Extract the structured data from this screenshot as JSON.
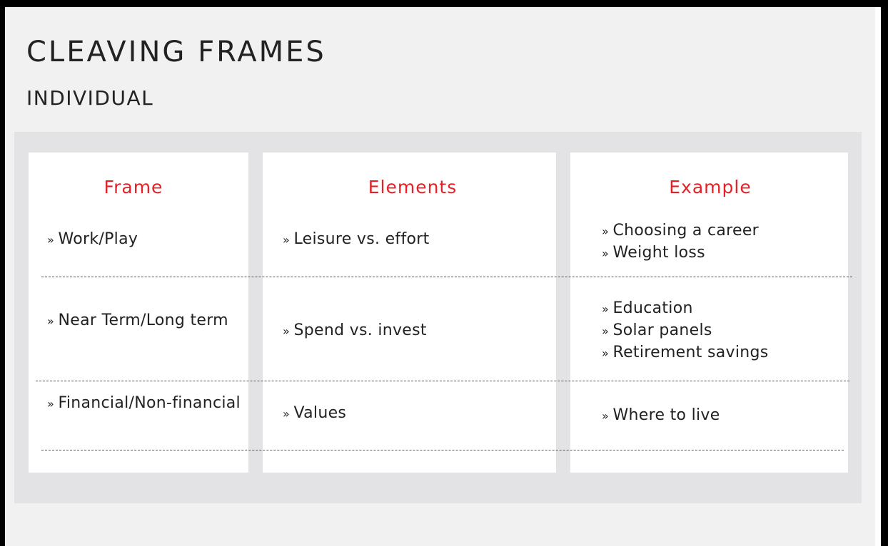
{
  "title": "CLEAVING FRAMES",
  "subtitle": "INDIVIDUAL",
  "headers": {
    "frame": "Frame",
    "elements": "Elements",
    "example": "Example"
  },
  "rows": [
    {
      "frame": "Work/Play",
      "elements": "Leisure vs. effort",
      "examples": [
        "Choosing a career",
        "Weight loss"
      ]
    },
    {
      "frame": "Near Term/Long term",
      "elements": "Spend vs. invest",
      "examples": [
        "Education",
        "Solar panels",
        "Retirement savings"
      ]
    },
    {
      "frame": "Financial/Non-financial",
      "elements": "Values",
      "examples": [
        "Where to live"
      ]
    }
  ],
  "colors": {
    "header_accent": "#e32127",
    "background": "#f1f1f2",
    "panel": "#e3e3e5"
  }
}
